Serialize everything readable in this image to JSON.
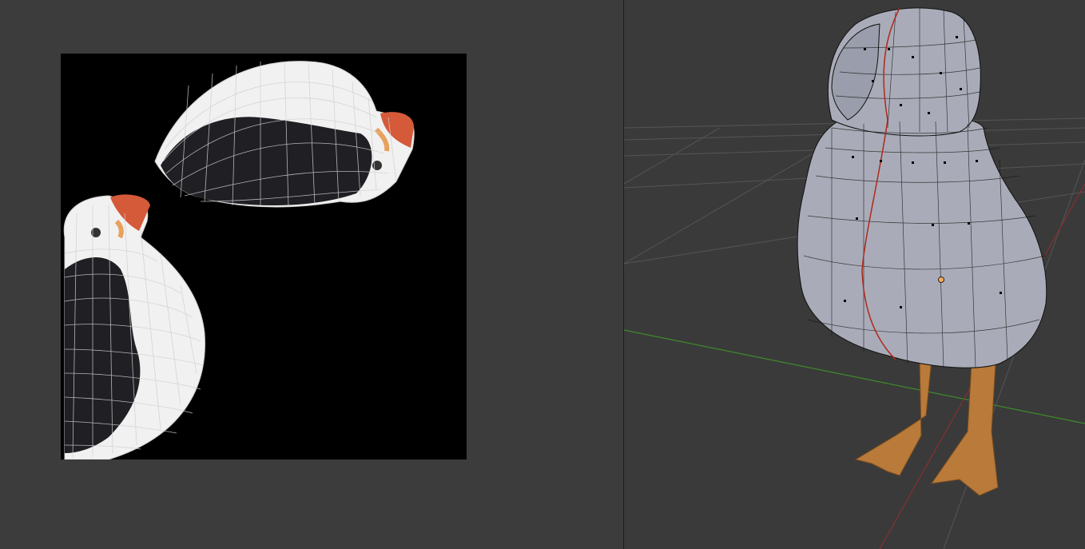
{
  "uv_editor": {
    "islands": [
      {
        "name": "puffin-island-horizontal",
        "body_color": "#1e1e22",
        "belly_color": "#f2f2f2",
        "beak_color": "#d45a3a"
      },
      {
        "name": "puffin-island-vertical",
        "body_color": "#1e1e22",
        "belly_color": "#f2f2f2",
        "beak_color": "#d45a3a"
      }
    ],
    "wire_color": "#d8d8d8",
    "background_color": "#000000"
  },
  "viewport_3d": {
    "mesh_color": "#a9acb8",
    "wire_color": "#111111",
    "seam_color": "#b0281c",
    "feet_color": "#b97a3a",
    "x_axis_color": "#8a2f2f",
    "y_axis_color": "#3d8b2a",
    "grid_color": "#555555",
    "origin_color": "#f2a85a"
  }
}
